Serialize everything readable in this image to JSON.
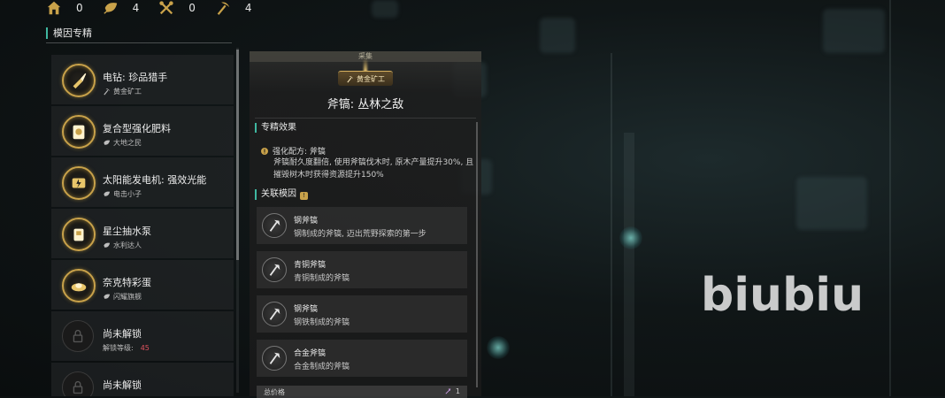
{
  "resources": [
    {
      "icon": "house-icon",
      "value": "0"
    },
    {
      "icon": "leaf-icon",
      "value": "4"
    },
    {
      "icon": "tools-icon",
      "value": "0"
    },
    {
      "icon": "pickaxe-icon",
      "value": "4"
    }
  ],
  "left_panel": {
    "title": "模因专精",
    "items": [
      {
        "name": "电钻: 珍品猎手",
        "tag": "黄金矿工",
        "tag_icon": "pickaxe-icon",
        "icon": "drill-icon",
        "unlocked": true
      },
      {
        "name": "复合型强化肥料",
        "tag": "大地之民",
        "tag_icon": "leaf-icon",
        "icon": "fertilizer-icon",
        "unlocked": true
      },
      {
        "name": "太阳能发电机: 强效光能",
        "tag": "电击小子",
        "tag_icon": "leaf-icon",
        "icon": "solar-generator-icon",
        "unlocked": true
      },
      {
        "name": "星尘抽水泵",
        "tag": "水利达人",
        "tag_icon": "leaf-icon",
        "icon": "water-pump-icon",
        "unlocked": true
      },
      {
        "name": "奈克特彩蛋",
        "tag": "闪耀旗舰",
        "tag_icon": "leaf-icon",
        "icon": "egg-dish-icon",
        "unlocked": true
      },
      {
        "name": "尚未解锁",
        "tag": "解锁等级:",
        "level": "45",
        "icon": "lock-icon",
        "unlocked": false
      },
      {
        "name": "尚未解锁",
        "tag": "",
        "icon": "lock-icon",
        "unlocked": false
      }
    ]
  },
  "detail": {
    "category": "采集",
    "badge": "黄金矿工",
    "title": "斧镐: 丛林之敌",
    "effect_section": "专精效果",
    "effect_head": "强化配方: 斧镐",
    "effect_desc": "斧镐耐久度翻倍, 使用斧镐伐木时, 原木产量提升30%, 且摧毁树木时获得资源提升150%",
    "related_section": "关联模因",
    "genes": [
      {
        "name": "钢斧镐",
        "desc": "钢制成的斧镐, 迈出荒野探索的第一步"
      },
      {
        "name": "青铜斧镐",
        "desc": "青铜制成的斧镐"
      },
      {
        "name": "钢斧镐",
        "desc": "钢铁制成的斧镐"
      },
      {
        "name": "合金斧镐",
        "desc": "合金制成的斧镐"
      }
    ],
    "total_label": "总价格",
    "total_value": "1"
  },
  "watermark": "biubiu",
  "colors": {
    "gold": "#c9a24a",
    "accent": "#3fb7a0",
    "locked_level": "#e0525f"
  }
}
